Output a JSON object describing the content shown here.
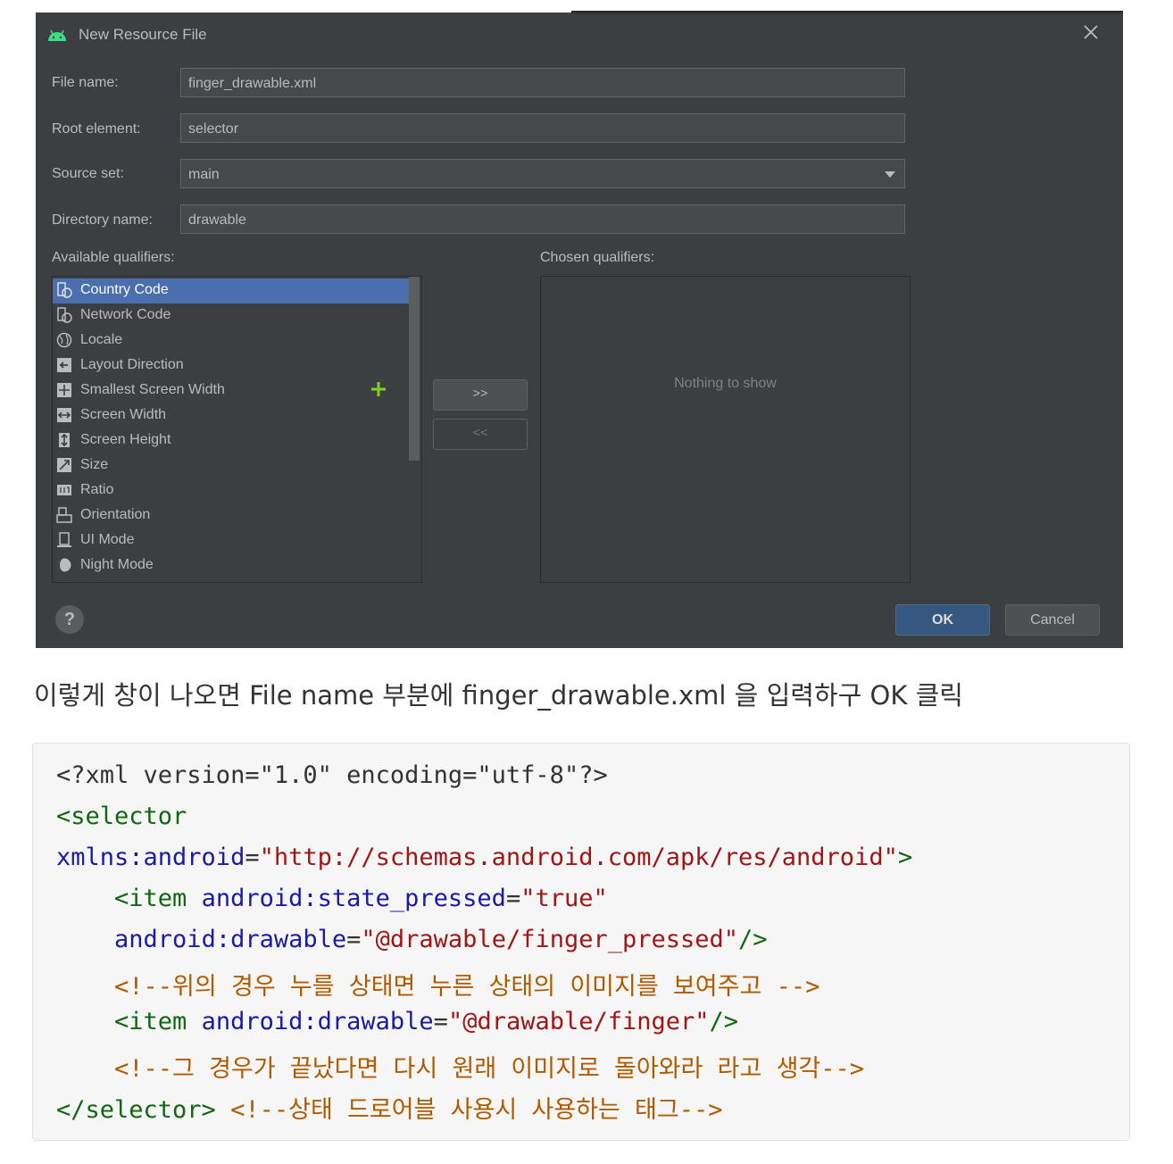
{
  "dialog": {
    "title": "New Resource File",
    "fields": {
      "file_name_label": "File name:",
      "file_name_value": "finger_drawable.xml",
      "root_element_label": "Root element:",
      "root_element_value": "selector",
      "source_set_label": "Source set:",
      "source_set_value": "main",
      "directory_name_label": "Directory name:",
      "directory_name_value": "drawable"
    },
    "available_qualifiers_label": "Available qualifiers:",
    "chosen_qualifiers_label": "Chosen qualifiers:",
    "qualifiers": [
      {
        "label": "Country Code",
        "icon": "country-code-icon",
        "selected": true
      },
      {
        "label": "Network Code",
        "icon": "network-code-icon",
        "selected": false
      },
      {
        "label": "Locale",
        "icon": "globe-icon",
        "selected": false
      },
      {
        "label": "Layout Direction",
        "icon": "layout-direction-icon",
        "selected": false
      },
      {
        "label": "Smallest Screen Width",
        "icon": "smallest-width-icon",
        "selected": false
      },
      {
        "label": "Screen Width",
        "icon": "screen-width-icon",
        "selected": false
      },
      {
        "label": "Screen Height",
        "icon": "screen-height-icon",
        "selected": false
      },
      {
        "label": "Size",
        "icon": "size-icon",
        "selected": false
      },
      {
        "label": "Ratio",
        "icon": "ratio-icon",
        "selected": false
      },
      {
        "label": "Orientation",
        "icon": "orientation-icon",
        "selected": false
      },
      {
        "label": "UI Mode",
        "icon": "ui-mode-icon",
        "selected": false
      },
      {
        "label": "Night Mode",
        "icon": "night-mode-icon",
        "selected": false
      }
    ],
    "add_button_label": ">>",
    "remove_button_label": "<<",
    "empty_text": "Nothing to show",
    "help_label": "?",
    "ok_label": "OK",
    "cancel_label": "Cancel"
  },
  "description": "이렇게 창이 나오면 File name 부분에 finger_drawable.xml 을 입력하구 OK 클릭",
  "code": {
    "l1": "<?xml version=\"1.0\" encoding=\"utf-8\"?>",
    "l2_tag": "<selector",
    "l3_attr": "xmlns:android",
    "l3_eq": "=",
    "l3_str": "\"http://schemas.android.com/apk/res/android\"",
    "l3_end": ">",
    "l4_tag": "<item",
    "l4_attr": "android:state_pressed",
    "l4_eq": "=",
    "l4_str": "\"true\"",
    "l5_attr": "android:drawable",
    "l5_eq": "=",
    "l5_str": "\"@drawable/finger_pressed\"",
    "l5_end": "/>",
    "l6_com": "<!--위의 경우 누를 상태면 누른 상태의 이미지를 보여주고 -->",
    "l7_tag": "<item",
    "l7_attr": "android:drawable",
    "l7_eq": "=",
    "l7_str": "\"@drawable/finger\"",
    "l7_end": "/>",
    "l8_com": "<!--그 경우가 끝났다면 다시 원래 이미지로 돌아와라 라고 생각-->",
    "l9_tag": "</selector>",
    "l9_com": "<!--상태 드로어블 사용시 사용하는 태그-->"
  },
  "colors": {
    "dialog_bg": "#3c3f41",
    "selection": "#4b6eaf",
    "ok_button": "#365880",
    "code_tag": "#116611",
    "code_attr": "#1a1aa6",
    "code_string": "#a31515",
    "code_comment": "#b05a00"
  }
}
